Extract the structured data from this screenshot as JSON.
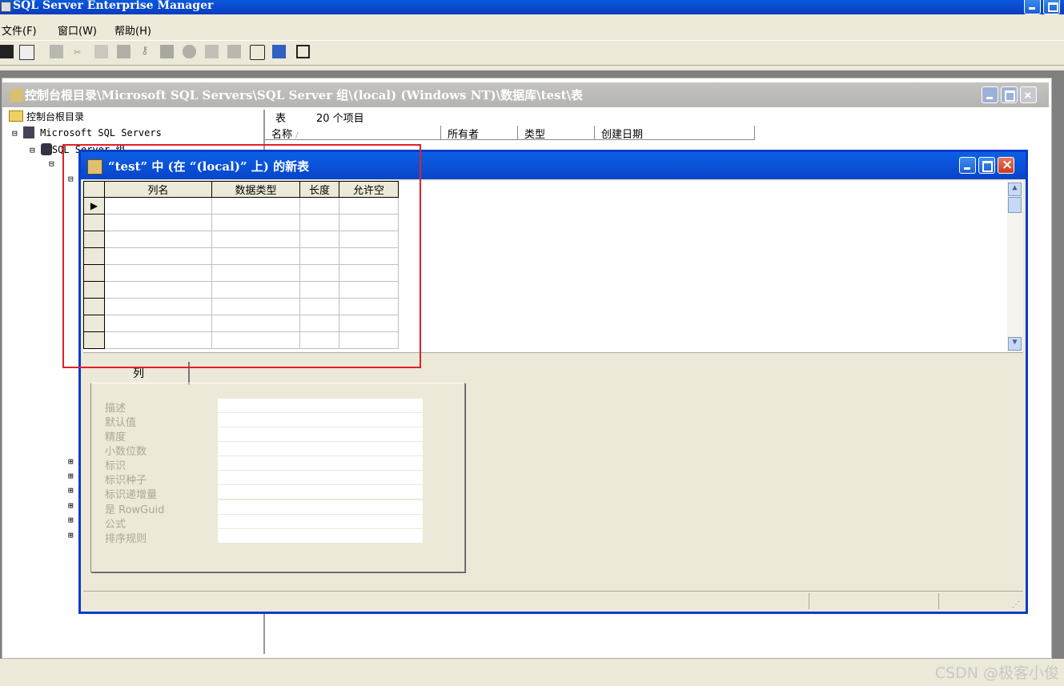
{
  "app": {
    "title": "SQL Server Enterprise Manager"
  },
  "menu": {
    "file": "文件(F)",
    "window": "窗口(W)",
    "help": "帮助(H)"
  },
  "console": {
    "title": "控制台根目录\\Microsoft SQL Servers\\SQL Server 组\\(local) (Windows NT)\\数据库\\test\\表",
    "tree": {
      "root": "控制台根目录",
      "servers": "Microsoft SQL Servers",
      "group": "SQL Server 组"
    },
    "list": {
      "kind": "表",
      "count": "20 个项目",
      "columns": [
        "名称",
        "所有者",
        "类型",
        "创建日期"
      ]
    }
  },
  "dialog": {
    "title": "“test” 中 (在 “(local)” 上) 的新表",
    "grid_headers": [
      "列名",
      "数据类型",
      "长度",
      "允许空"
    ],
    "tab_label": "列",
    "properties": [
      "描述",
      "默认值",
      "精度",
      "小数位数",
      "标识",
      "标识种子",
      "标识递增量",
      "是 RowGuid",
      "公式",
      "排序规则"
    ]
  },
  "watermark": "CSDN @极客小俊",
  "colors": {
    "annotation": "#e0202a",
    "active_title": "#0a48d4"
  }
}
